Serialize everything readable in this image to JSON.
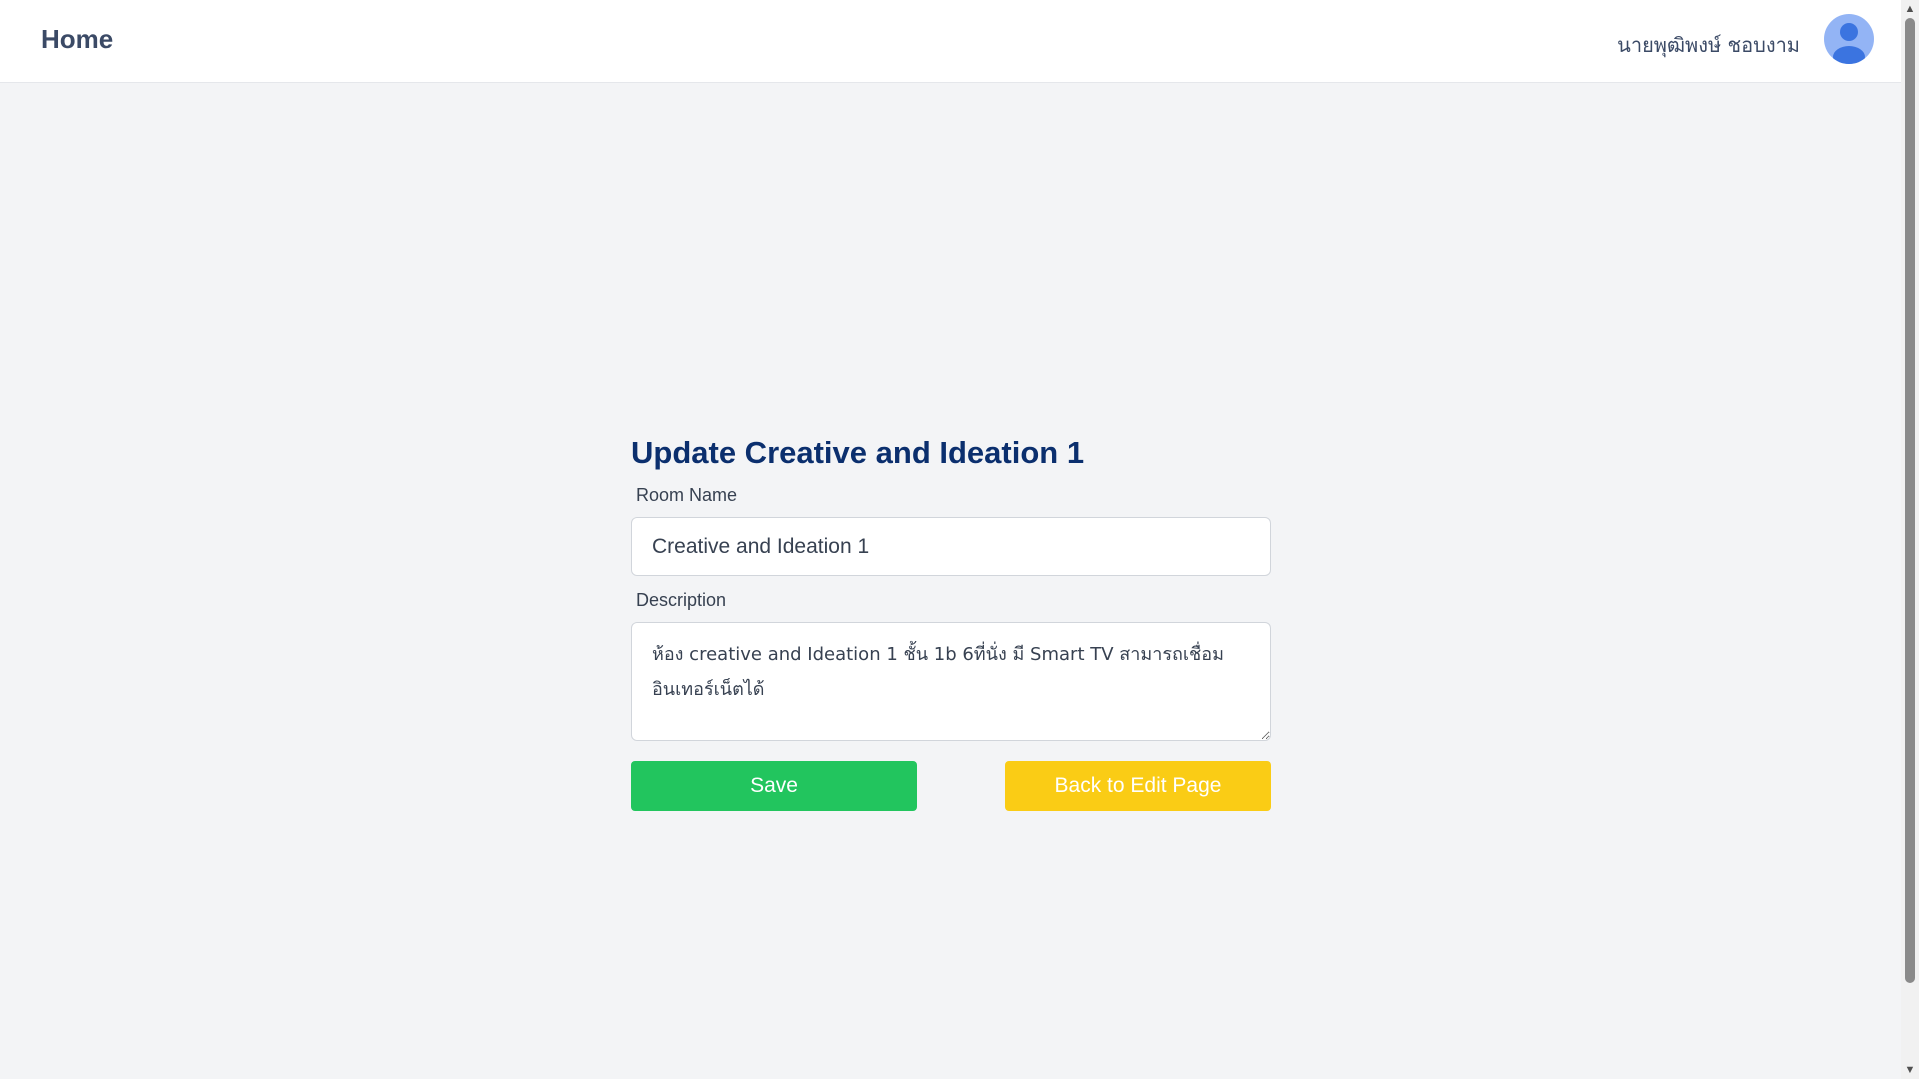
{
  "header": {
    "home_label": "Home",
    "user_name": "นายพุฒิพงษ์ ชอบงาม",
    "avatar_icon": "user-avatar-icon"
  },
  "form": {
    "title": "Update Creative and Ideation 1",
    "room_name_label": "Room Name",
    "room_name_value": "Creative and Ideation 1",
    "description_label": "Description",
    "description_value": "ห้อง creative and Ideation 1 ชั้น 1b 6ที่นั่ง มี Smart TV สามารถเชื่อม อินเทอร์เน็ตได้",
    "save_label": "Save",
    "back_label": "Back to Edit Page"
  },
  "colors": {
    "accent_title": "#0b2f6e",
    "save_button": "#22c55e",
    "back_button": "#facc15",
    "avatar_bg": "#93b4f5",
    "avatar_fg": "#3b74e0"
  }
}
